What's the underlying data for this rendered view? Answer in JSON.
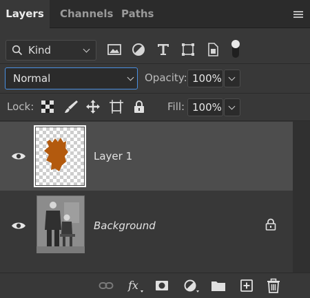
{
  "tabs": [
    {
      "label": "Layers",
      "active": true
    },
    {
      "label": "Channels",
      "active": false
    },
    {
      "label": "Paths",
      "active": false
    }
  ],
  "filter": {
    "kind_label": "Kind",
    "icons": [
      "image-filter-icon",
      "adjustment-filter-icon",
      "type-filter-icon",
      "shape-filter-icon",
      "smart-object-filter-icon",
      "filter-toggle-switch"
    ]
  },
  "blend": {
    "mode": "Normal",
    "opacity_label": "Opacity:",
    "opacity_value": "100%"
  },
  "lock": {
    "label": "Lock:",
    "fill_label": "Fill:",
    "fill_value": "100%"
  },
  "layers": [
    {
      "name": "Layer 1",
      "selected": true,
      "visible": true,
      "italic": false,
      "locked": false
    },
    {
      "name": "Background",
      "selected": false,
      "visible": true,
      "italic": true,
      "locked": true
    }
  ],
  "colors": {
    "accent_focus": "#4a90e2",
    "leaf_orange": "#b35a0e",
    "panel_bg": "#383838",
    "selected_row": "#4d4d4d"
  },
  "footer_icons": [
    "link-layers-icon",
    "fx-icon",
    "add-mask-icon",
    "adjustment-layer-icon",
    "new-group-icon",
    "new-layer-icon",
    "delete-layer-icon"
  ]
}
